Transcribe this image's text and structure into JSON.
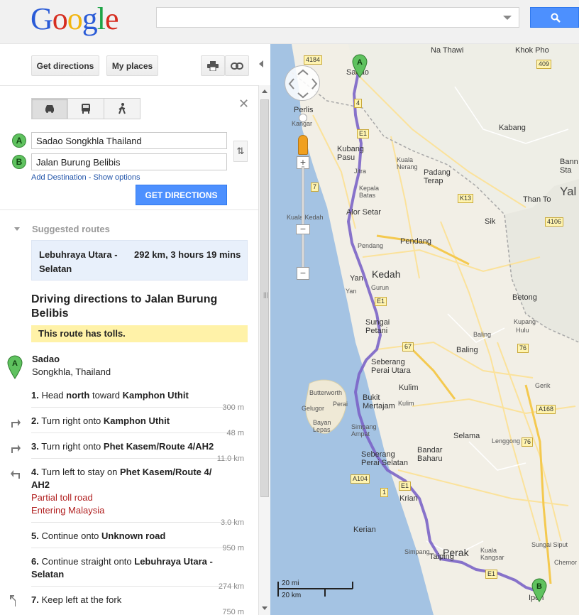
{
  "header": {
    "logo": "Google",
    "search_value": "",
    "search_icon": "magnifier-icon"
  },
  "toolbar": {
    "get_directions_label": "Get directions",
    "my_places_label": "My places",
    "print_icon": "printer-icon",
    "link_icon": "link-icon"
  },
  "travel_modes": [
    "car-icon",
    "transit-icon",
    "walking-icon"
  ],
  "waypoints": [
    {
      "marker": "A",
      "value": "Sadao Songkhla Thailand"
    },
    {
      "marker": "B",
      "value": "Jalan Burung Belibis"
    }
  ],
  "links": {
    "add_destination": "Add Destination",
    "separator": " - ",
    "show_options": "Show options"
  },
  "get_directions_button": "GET DIRECTIONS",
  "suggested": {
    "title": "Suggested routes",
    "route_name": "Lebuhraya Utara - Selatan",
    "route_info": "292 km, 3 hours 19 mins"
  },
  "directions": {
    "title": "Driving directions to Jalan Burung Belibis",
    "tolls_notice": "This route has tolls.",
    "origin": {
      "marker": "A",
      "name": "Sadao",
      "sub": "Songkhla, Thailand"
    },
    "steps": [
      {
        "num": "1.",
        "pre": " Head ",
        "b1": "north",
        "mid": " toward ",
        "b2": "Kamphon Uthit",
        "note1": "",
        "note2": "",
        "dist": "300 m"
      },
      {
        "num": "2.",
        "pre": " Turn right onto ",
        "b1": "Kamphon Uthit",
        "mid": "",
        "b2": "",
        "note1": "",
        "note2": "",
        "dist": "48 m"
      },
      {
        "num": "3.",
        "pre": " Turn right onto ",
        "b1": "Phet Kasem/Route 4/AH2",
        "mid": "",
        "b2": "",
        "note1": "",
        "note2": "",
        "dist": "11.0 km"
      },
      {
        "num": "4.",
        "pre": " Turn left to stay on ",
        "b1": "Phet Kasem/Route 4/ AH2",
        "mid": "",
        "b2": "",
        "note1": "Partial toll road",
        "note2": "Entering Malaysia",
        "dist": "3.0 km"
      },
      {
        "num": "5.",
        "pre": " Continue onto ",
        "b1": "Unknown road",
        "mid": "",
        "b2": "",
        "note1": "",
        "note2": "",
        "dist": "950 m"
      },
      {
        "num": "6.",
        "pre": " Continue straight onto ",
        "b1": "Lebuhraya Utara - Selatan",
        "mid": "",
        "b2": "",
        "note1": "",
        "note2": "",
        "dist": "274 km"
      },
      {
        "num": "7.",
        "pre": " Keep left at the fork",
        "b1": "",
        "mid": "",
        "b2": "",
        "note1": "",
        "note2": "",
        "dist": "750 m"
      }
    ]
  },
  "map": {
    "labels": {
      "sadao": "Sadao",
      "na_thawi": "Na Thawi",
      "khok_pho": "Khok Pho",
      "perlis": "Perlis",
      "kangar": "Kangar",
      "kabang": "Kabang",
      "kubang_pasu": "Kubang\nPasu",
      "jitra": "Jitra",
      "kuala_nerang": "Kuala\nNerang",
      "padang_terap": "Padang\nTerap",
      "kepala_batas": "Kepala\nBatas",
      "bann": "Bann\nSta",
      "yala": "Yal",
      "than_to": "Than To",
      "kuala_kedah": "Kuala Kedah",
      "alor_setar": "Alor Setar",
      "sik": "Sik",
      "pendang_small": "Pendang",
      "pendang": "Pendang",
      "yan": "Yan",
      "kedah": "Kedah",
      "gurun": "Gurun",
      "yan2": "Yan",
      "betong": "Betong",
      "sungai_petani": "Sungai\nPetani",
      "baling_small": "Baling",
      "kupang": "Kupang",
      "hulu": "Hulu",
      "baling": "Baling",
      "seberang_perai_utara": "Seberang\nPerai Utara",
      "butterworth": "Butterworth",
      "gelugor": "Gelugor",
      "perai": "Perai",
      "bukit_mertajam": "Bukit\nMertajam",
      "kulim": "Kulim",
      "kulim2": "Kulim",
      "gerik": "Gerik",
      "bayan_lepas": "Bayan\nLepas",
      "simpang_ampat": "Simpang\nAmpat",
      "selama": "Selama",
      "seberang_perai_selatan": "Seberang\nPerai Selatan",
      "bandar_baharu": "Bandar\nBaharu",
      "lenggong": "Lenggong",
      "krian": "Krian",
      "kerian": "Kerian",
      "taiping": "Taiping",
      "perak": "Perak",
      "kuala_kangsar": "Kuala\nKangsar",
      "sungai_siput": "Sungai Siput",
      "chemor": "Chemor",
      "simpang": "Simpang",
      "ipoh": "Ipoh"
    },
    "shields": [
      "4184",
      "409",
      "4",
      "E1",
      "7",
      "K13",
      "4106",
      "E1",
      "67",
      "76",
      "A168",
      "76",
      "A104",
      "1",
      "E1",
      "E1"
    ],
    "markers": [
      "A",
      "B"
    ],
    "scale": {
      "miles": "20 mi",
      "km": "20 km"
    }
  }
}
